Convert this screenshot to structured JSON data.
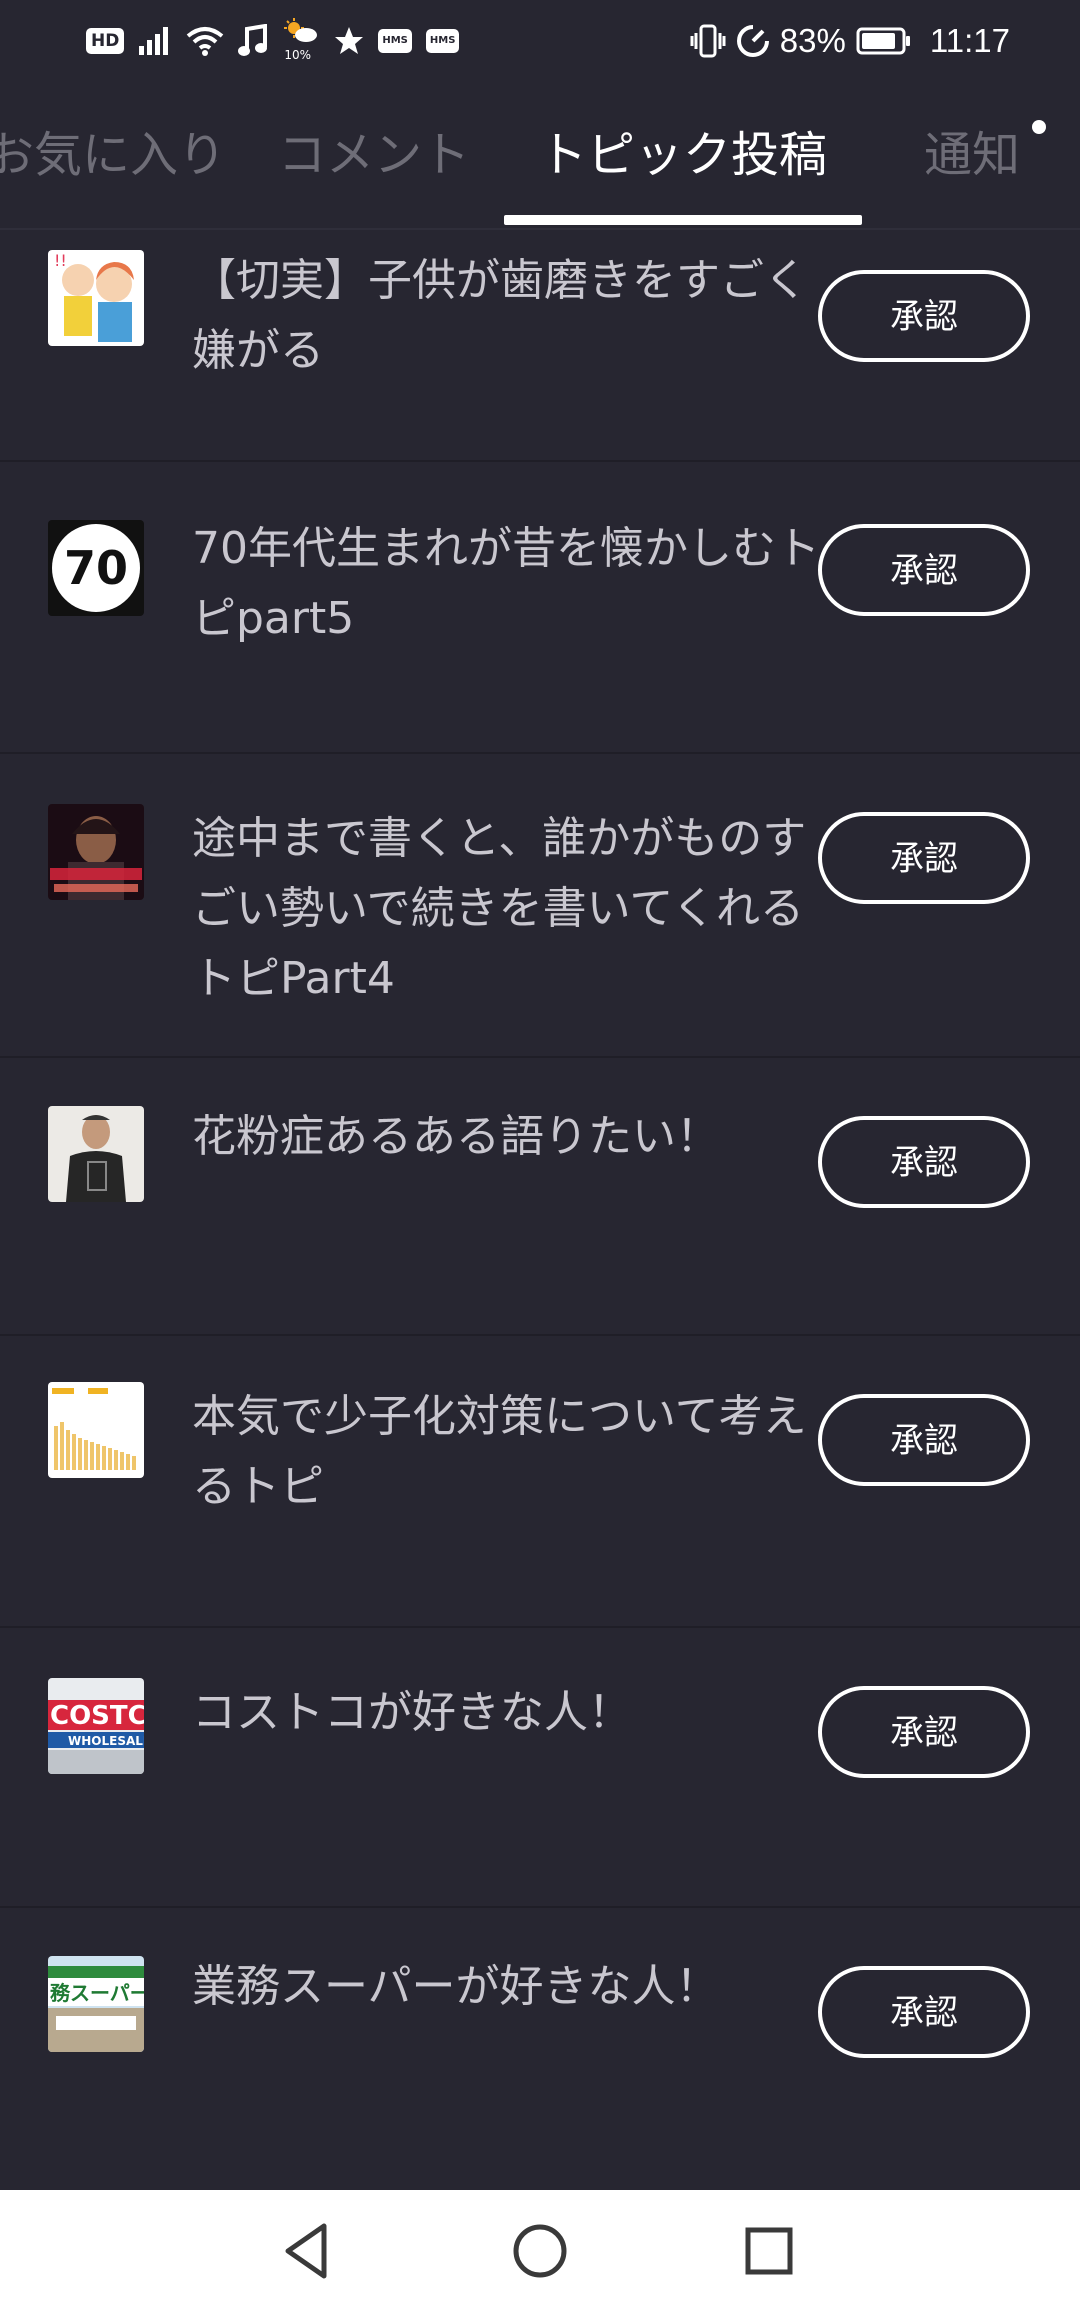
{
  "status_bar": {
    "hd_label": "HD",
    "weather_pct": "10%",
    "hms_label_1": "HMS",
    "hms_label_2": "HMS",
    "battery_pct": "83%",
    "time": "11:17",
    "icons": [
      "signal-icon",
      "wifi-icon",
      "music-note-icon",
      "weather-icon",
      "star-icon",
      "vibrate-icon",
      "data-saver-icon",
      "battery-icon"
    ]
  },
  "tabs": [
    {
      "label": "お気に入り",
      "active": false
    },
    {
      "label": "コメント",
      "active": false
    },
    {
      "label": "トピック投稿",
      "active": true
    },
    {
      "label": "通知",
      "active": false,
      "has_dot": true
    }
  ],
  "topics": [
    {
      "title": "【切実】子供が歯磨きをすごく嫌がる",
      "button": "承認",
      "thumb_icon": "cartoon-family-thumbnail"
    },
    {
      "title": "70年代生まれが昔を懐かしむトピpart5",
      "button": "承認",
      "thumb_icon": "number-70-thumbnail",
      "thumb_text": "70"
    },
    {
      "title": "途中まで書くと、誰かがものすごい勢いで続きを書いてくれるトピPart4",
      "button": "承認",
      "thumb_icon": "person-photo-thumbnail"
    },
    {
      "title": "花粉症あるある語りたい！",
      "button": "承認",
      "thumb_icon": "person-tshirt-thumbnail"
    },
    {
      "title": "本気で少子化対策について考えるトピ",
      "button": "承認",
      "thumb_icon": "bar-chart-thumbnail"
    },
    {
      "title": "コストコが好きな人！",
      "button": "承認",
      "thumb_icon": "costco-sign-thumbnail",
      "thumb_text": "COSTCO",
      "thumb_text_2": "WHOLESALE"
    },
    {
      "title": "業務スーパーが好きな人！",
      "button": "承認",
      "thumb_icon": "gyomu-super-thumbnail",
      "thumb_text": "務スーパー"
    }
  ],
  "nav": {
    "icons": [
      "back-triangle-icon",
      "home-circle-icon",
      "recents-square-icon"
    ]
  },
  "colors": {
    "background": "#272631",
    "text": "#c9c7cf",
    "tab_inactive": "#6e6d77",
    "accent": "#ffffff"
  }
}
